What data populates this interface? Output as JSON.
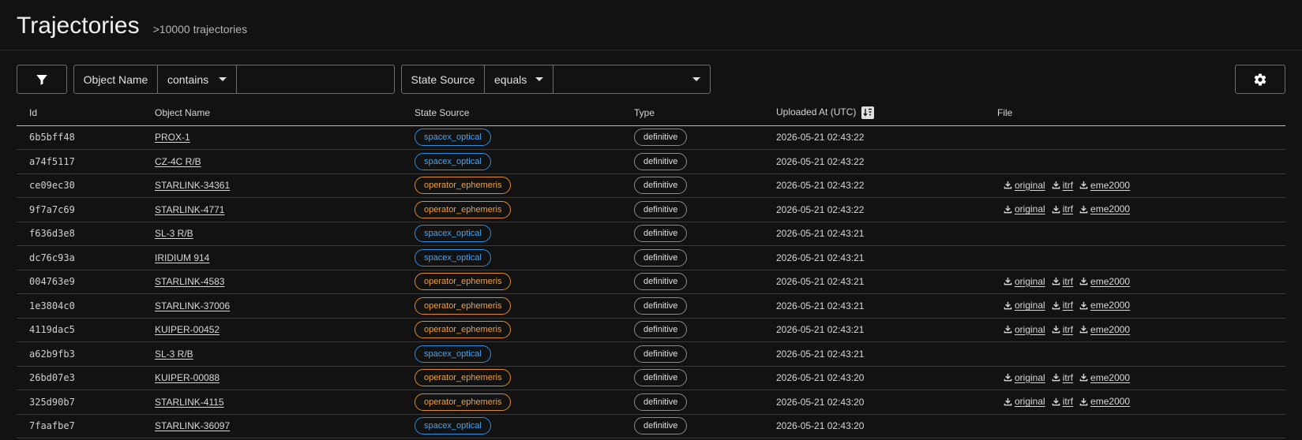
{
  "header": {
    "title": "Trajectories",
    "subtitle": ">10000 trajectories"
  },
  "filters": [
    {
      "field": "Object Name",
      "operator": "contains",
      "value": "",
      "kind": "text"
    },
    {
      "field": "State Source",
      "operator": "equals",
      "value": "",
      "kind": "select"
    }
  ],
  "icons": {
    "filter": "filter-icon",
    "settings": "gear-icon",
    "sort": "sort-descending-icon",
    "download": "download-icon"
  },
  "colors": {
    "spacex_optical": "#2f8ee0",
    "operator_ephemeris": "#e08b2a",
    "background": "#121212"
  },
  "table": {
    "columns": [
      "Id",
      "Object Name",
      "State Source",
      "Type",
      "Uploaded At (UTC)",
      "File"
    ],
    "file_labels": [
      "original",
      "itrf",
      "eme2000"
    ],
    "rows": [
      {
        "id": "6b5bff48",
        "name": "PROX-1",
        "source": "spacex_optical",
        "type": "definitive",
        "uploaded": "2026-05-21 02:43:22",
        "files": false
      },
      {
        "id": "a74f5117",
        "name": "CZ-4C R/B",
        "source": "spacex_optical",
        "type": "definitive",
        "uploaded": "2026-05-21 02:43:22",
        "files": false
      },
      {
        "id": "ce09ec30",
        "name": "STARLINK-34361",
        "source": "operator_ephemeris",
        "type": "definitive",
        "uploaded": "2026-05-21 02:43:22",
        "files": true
      },
      {
        "id": "9f7a7c69",
        "name": "STARLINK-4771",
        "source": "operator_ephemeris",
        "type": "definitive",
        "uploaded": "2026-05-21 02:43:22",
        "files": true
      },
      {
        "id": "f636d3e8",
        "name": "SL-3 R/B",
        "source": "spacex_optical",
        "type": "definitive",
        "uploaded": "2026-05-21 02:43:21",
        "files": false
      },
      {
        "id": "dc76c93a",
        "name": "IRIDIUM 914",
        "source": "spacex_optical",
        "type": "definitive",
        "uploaded": "2026-05-21 02:43:21",
        "files": false
      },
      {
        "id": "004763e9",
        "name": "STARLINK-4583",
        "source": "operator_ephemeris",
        "type": "definitive",
        "uploaded": "2026-05-21 02:43:21",
        "files": true
      },
      {
        "id": "1e3804c0",
        "name": "STARLINK-37006",
        "source": "operator_ephemeris",
        "type": "definitive",
        "uploaded": "2026-05-21 02:43:21",
        "files": true
      },
      {
        "id": "4119dac5",
        "name": "KUIPER-00452",
        "source": "operator_ephemeris",
        "type": "definitive",
        "uploaded": "2026-05-21 02:43:21",
        "files": true
      },
      {
        "id": "a62b9fb3",
        "name": "SL-3 R/B",
        "source": "spacex_optical",
        "type": "definitive",
        "uploaded": "2026-05-21 02:43:21",
        "files": false
      },
      {
        "id": "26bd07e3",
        "name": "KUIPER-00088",
        "source": "operator_ephemeris",
        "type": "definitive",
        "uploaded": "2026-05-21 02:43:20",
        "files": true
      },
      {
        "id": "325d90b7",
        "name": "STARLINK-4115",
        "source": "operator_ephemeris",
        "type": "definitive",
        "uploaded": "2026-05-21 02:43:20",
        "files": true
      },
      {
        "id": "7faafbe7",
        "name": "STARLINK-36097",
        "source": "spacex_optical",
        "type": "definitive",
        "uploaded": "2026-05-21 02:43:20",
        "files": false
      }
    ]
  }
}
